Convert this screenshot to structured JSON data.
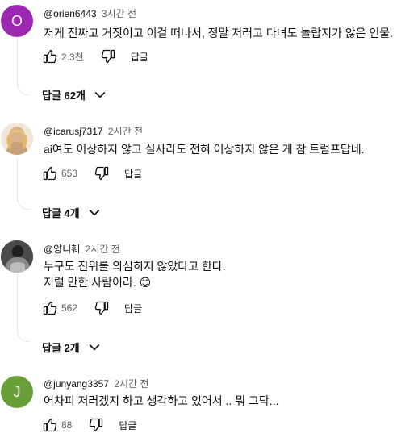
{
  "comments": [
    {
      "avatar_letter": "O",
      "avatar_color": "#9c27b0",
      "author": "@orien6443",
      "time": "3시간 전",
      "lines": [
        "저게 진짜고 거짓이고 이걸 떠나서, 정말 저러고 다녀도 놀랍지가 않은 인물."
      ],
      "likes": "2.3천",
      "reply_label": "답글",
      "replies_label": "답글 62개"
    },
    {
      "avatar_letter": "",
      "avatar_color": "#e8d9c8",
      "author": "@icarusj7317",
      "time": "2시간 전",
      "lines": [
        "ai여도 이상하지 않고 실사라도 전혀 이상하지 않은 게 참 트럼프답네."
      ],
      "likes": "653",
      "reply_label": "답글",
      "replies_label": "답글 4개"
    },
    {
      "avatar_letter": "",
      "avatar_color": "#3a3a3a",
      "author": "@양니훼",
      "time": "2시간 전",
      "lines": [
        "누구도 진위를 의심히지 않았다고 한다.",
        "저럴 만한 사람이라. 😊"
      ],
      "likes": "562",
      "reply_label": "답글",
      "replies_label": "답글 2개"
    },
    {
      "avatar_letter": "J",
      "avatar_color": "#689f38",
      "author": "@junyang3357",
      "time": "2시간 전",
      "lines": [
        "어차피 저러겠지 하고 생각하고 있어서 .. 뭐 그닥..."
      ],
      "likes": "88",
      "reply_label": "답글"
    }
  ]
}
